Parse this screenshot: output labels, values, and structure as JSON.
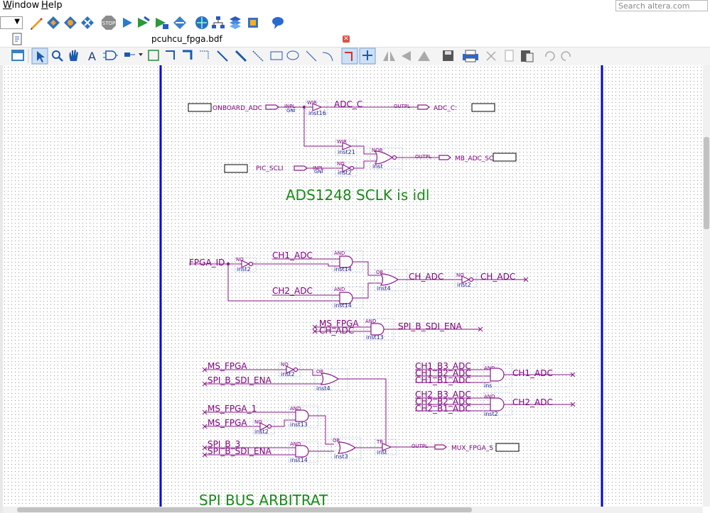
{
  "menu": {
    "window": "Window",
    "help": "Help"
  },
  "search": {
    "placeholder": "Search altera.com"
  },
  "document": {
    "title": "pcuhcu_fpga.bdf"
  },
  "schematic": {
    "comments": {
      "ads_idle": "ADS1248 SCLK is idl",
      "arbitration": "SPI BUS ARBITRAT"
    },
    "pins": {
      "onboard_adc": "ONBOARD_ADC",
      "pic_scl": "PIC_SCLI",
      "adc_c_out": "ADC_C:",
      "mb_adc_out": "MB_ADC_SC",
      "mux_fpga_out": "MUX_FPGA_S",
      "input_tag": "INPL",
      "output_tag": "OUTPL",
      "vcc_tag": "GNI"
    },
    "nets": {
      "adc_c": "ADC_C",
      "fpga_id": "FPGA_ID",
      "ch1_adc": "CH1_ADC",
      "ch2_adc": "CH2_ADC",
      "ch_adc": "CH_ADC",
      "ch_adc_n": "CH_ADC",
      "ms_fpga_1": "MS_FPGA",
      "ch_adc_2": "CH_ADC",
      "spi_b_sdi_ena_1": "SPI_B_SDI_ENA",
      "ms_fpga_2": "MS_FPGA",
      "spi_b_sdi_ena_2": "SPI_B_SDI_ENA",
      "ms_fpga_3": "MS_FPGA_1",
      "ms_fpga_4": "MS_FPGA",
      "spi_b_3": "SPI_B_3",
      "spi_b_sdi_ena_3": "SPI_B_SDI_ENA",
      "ch1_b3": "CH1_B3_ADC",
      "ch1_b2": "CH1_B2_ADC",
      "ch1_b1": "CH1_B1_ADC",
      "ch1_adc_out": "CH1_ADC",
      "ch2_b3": "CH2_B3_ADC",
      "ch2_b2": "CH2_B2_ADC",
      "ch2_b1": "CH2_B1_ADC",
      "ch2_adc_out": "CH2_ADC"
    },
    "gates": {
      "wire": "WIR",
      "not": "NO",
      "nor": "NOR",
      "and": "AND",
      "or": "OR",
      "tri": "TR",
      "inst16": "inst16",
      "inst21": "inst21",
      "inst2": "inst2",
      "inst": "inst",
      "inst14": "inst14",
      "inst4": "inst4",
      "inst13": "inst13",
      "inst3": "inst3",
      "ins": "ins"
    }
  },
  "colors": {
    "wire": "#8a1a8a",
    "label": "#800080",
    "instance": "#1a1a8a",
    "comment": "#1a8a1a",
    "border": "#0000e0",
    "pin": "#000000"
  },
  "icons": [
    "edit-icon",
    "compile-icon",
    "analyze-icon",
    "fitter-icon",
    "stop-icon",
    "start-icon",
    "timing-icon",
    "assembler-icon",
    "programmer-icon",
    "rtl-viewer-icon",
    "netlist-icon",
    "chip-planner-icon",
    "package-icon",
    "help-bubble-icon"
  ]
}
